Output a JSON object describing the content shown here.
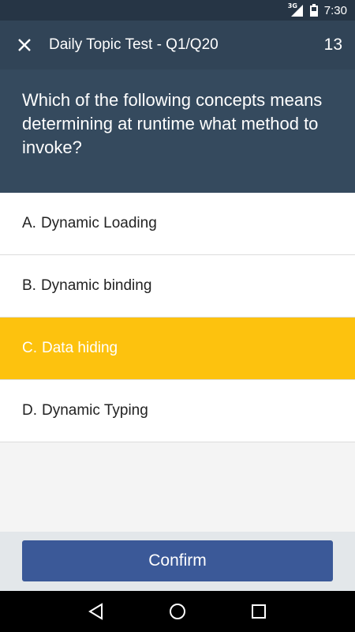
{
  "status_bar": {
    "network": "3G",
    "time": "7:30"
  },
  "toolbar": {
    "title": "Daily Topic Test - Q1/Q20",
    "counter": "13"
  },
  "question": {
    "text": "Which of the following concepts means determining at runtime what method to invoke?"
  },
  "options": [
    {
      "letter": "A.",
      "text": "Dynamic Loading",
      "selected": false
    },
    {
      "letter": "B.",
      "text": "Dynamic binding",
      "selected": false
    },
    {
      "letter": "C.",
      "text": "Data hiding",
      "selected": true
    },
    {
      "letter": "D.",
      "text": "Dynamic Typing",
      "selected": false
    }
  ],
  "footer": {
    "confirm_label": "Confirm"
  },
  "colors": {
    "header": "#354a5e",
    "selected": "#fdc20e",
    "confirm": "#3b5998"
  },
  "icons": {
    "close": "close-icon",
    "back": "back-triangle-icon",
    "home": "home-circle-icon",
    "recents": "recents-square-icon"
  }
}
